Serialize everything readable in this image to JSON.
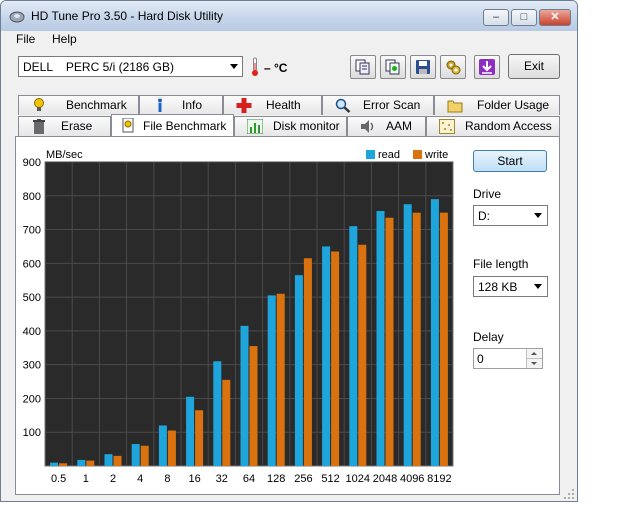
{
  "window": {
    "title": "HD Tune Pro 3.50 - Hard Disk Utility",
    "minimize": "–",
    "maximize": "□",
    "close": "✕"
  },
  "menu": {
    "file": "File",
    "help": "Help"
  },
  "toolbar": {
    "drive": "DELL    PERC 5/i (2186 GB)",
    "temperature": "– °C",
    "exit_label": "Exit",
    "icons": [
      "copy-icon",
      "copy-info-icon",
      "save-icon",
      "options-icon",
      "download-icon"
    ]
  },
  "tabs": {
    "row1": [
      {
        "label": "Benchmark",
        "icon": "benchmark-icon"
      },
      {
        "label": "Info",
        "icon": "info-icon"
      },
      {
        "label": "Health",
        "icon": "health-icon"
      },
      {
        "label": "Error Scan",
        "icon": "magnifier-icon"
      },
      {
        "label": "Folder Usage",
        "icon": "folder-icon"
      }
    ],
    "row2": [
      {
        "label": "Erase",
        "icon": "erase-icon"
      },
      {
        "label": "File Benchmark",
        "icon": "file-benchmark-icon",
        "active": true
      },
      {
        "label": "Disk monitor",
        "icon": "disk-monitor-icon"
      },
      {
        "label": "AAM",
        "icon": "speaker-icon"
      },
      {
        "label": "Random Access",
        "icon": "random-access-icon"
      }
    ]
  },
  "side": {
    "start_label": "Start",
    "drive_label": "Drive",
    "drive_value": "D:",
    "file_length_label": "File length",
    "file_length_value": "128 KB",
    "delay_label": "Delay",
    "delay_value": "0"
  },
  "colors": {
    "read": "#1ea6dc",
    "write": "#d9720f",
    "plot_bg": "#2a2a2a"
  },
  "chart_data": {
    "type": "bar",
    "ylabel": "MB/sec",
    "ylim": [
      0,
      900
    ],
    "yticks": [
      100,
      200,
      300,
      400,
      500,
      600,
      700,
      800,
      900
    ],
    "categories": [
      "0.5",
      "1",
      "2",
      "4",
      "8",
      "16",
      "32",
      "64",
      "128",
      "256",
      "512",
      "1024",
      "2048",
      "4096",
      "8192"
    ],
    "series": [
      {
        "name": "read",
        "values": [
          10,
          18,
          35,
          65,
          120,
          205,
          310,
          415,
          505,
          565,
          650,
          710,
          755,
          775,
          790
        ]
      },
      {
        "name": "write",
        "values": [
          8,
          16,
          30,
          60,
          105,
          165,
          255,
          355,
          510,
          615,
          635,
          655,
          735,
          750,
          750
        ]
      }
    ],
    "legend": "top-right",
    "grid": true
  }
}
